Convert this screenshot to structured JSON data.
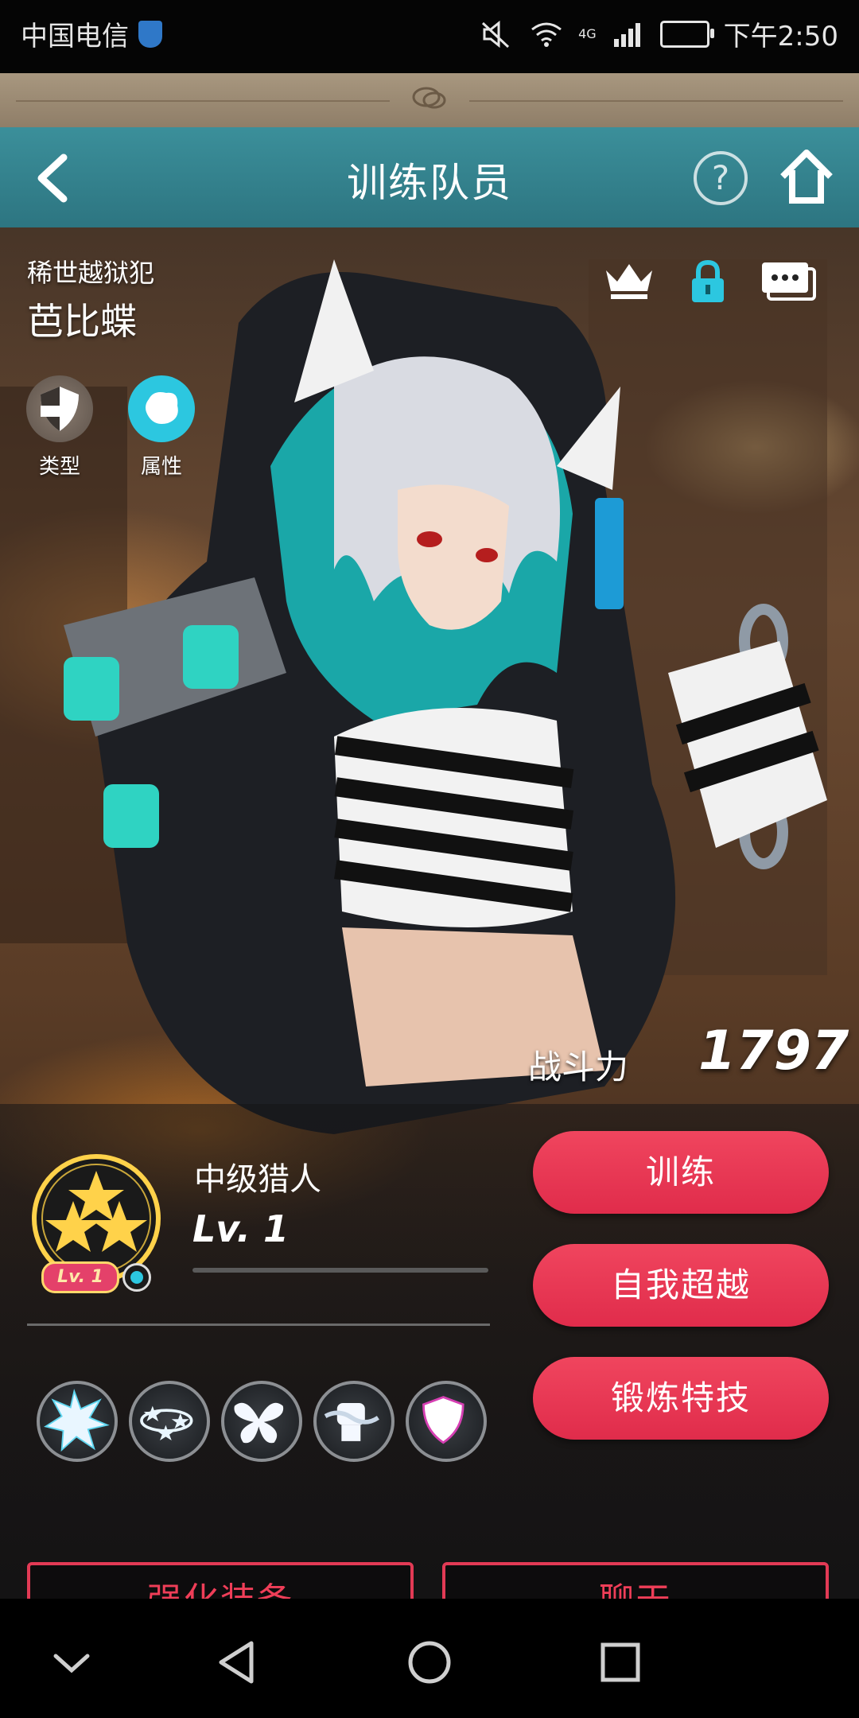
{
  "status_bar": {
    "carrier": "中国电信",
    "time": "下午2:50",
    "network": "4G"
  },
  "header": {
    "title": "训练队员"
  },
  "character": {
    "subtitle": "稀世越狱犯",
    "name": "芭比蝶",
    "attributes": [
      {
        "label": "类型",
        "icon": "shield-icon"
      },
      {
        "label": "属性",
        "icon": "element-icon"
      }
    ],
    "power_label": "战斗力",
    "power_value": "1797"
  },
  "rank": {
    "title": "中级猎人",
    "level": "Lv. 1",
    "badge_level": "Lv. 1",
    "stars": 3
  },
  "actions": {
    "train": "训练",
    "transcend": "自我超越",
    "forge_skill": "锻炼特技",
    "enhance_equipment": "强化装备",
    "chat": "聊天"
  },
  "skills": [
    {
      "icon": "burst-skill-icon"
    },
    {
      "icon": "stars-orbit-skill-icon"
    },
    {
      "icon": "butterfly-skill-icon"
    },
    {
      "icon": "chained-fist-skill-icon"
    },
    {
      "icon": "shield-skill-icon"
    }
  ],
  "colors": {
    "header_teal": "#3b8f9a",
    "accent_pink": "#e8354f",
    "attribute_cyan": "#2cc7e0",
    "star_gold": "#ffd24a"
  }
}
